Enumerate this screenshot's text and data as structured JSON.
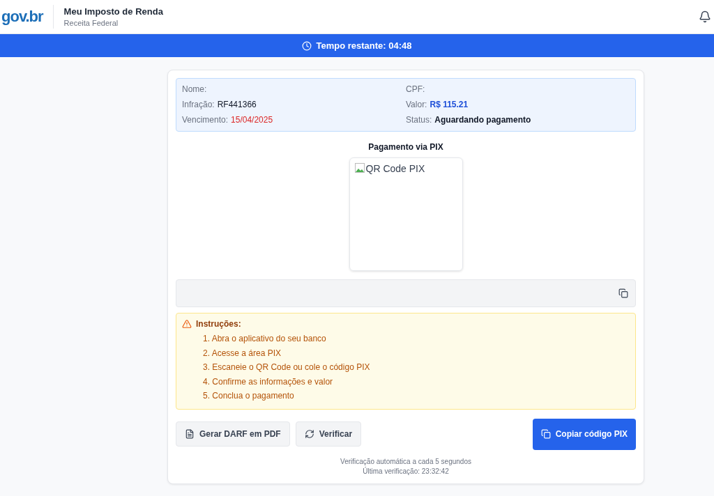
{
  "header": {
    "logo": "gov.br",
    "title": "Meu Imposto de Renda",
    "subtitle": "Receita Federal"
  },
  "timer_bar": {
    "text": "Tempo restante: 04:48"
  },
  "info": {
    "columns": [
      [
        {
          "label": "Nome:"
        },
        {
          "label": "Infração:",
          "value": "RF441366",
          "kind": "plain"
        },
        {
          "label": "Vencimento:",
          "value": "15/04/2025",
          "kind": "danger"
        }
      ],
      [
        {
          "label": "CPF:"
        },
        {
          "label": "Valor:",
          "value": "R$ 115.21",
          "kind": "primary"
        },
        {
          "label": "Status:",
          "value": "Aguardando pagamento",
          "kind": "strong"
        }
      ]
    ]
  },
  "payment": {
    "title": "Pagamento via PIX",
    "qr_alt": "QR Code PIX"
  },
  "instructions": {
    "title": "Instruções:",
    "steps": [
      "1. Abra o aplicativo do seu banco",
      "2. Acesse a área PIX",
      "3. Escaneie o QR Code ou cole o código PIX",
      "4. Confirme as informações e valor",
      "5. Conclua o pagamento"
    ]
  },
  "buttons": [
    {
      "label": "Gerar DARF em PDF",
      "kind": "secondary"
    },
    {
      "label": "Verificar",
      "kind": "secondary"
    },
    {
      "label": "Copiar código PIX",
      "kind": "primary"
    }
  ],
  "footer": [
    "Verificação automática a cada 5 segundos",
    "Última verificação: 23:32:42"
  ]
}
